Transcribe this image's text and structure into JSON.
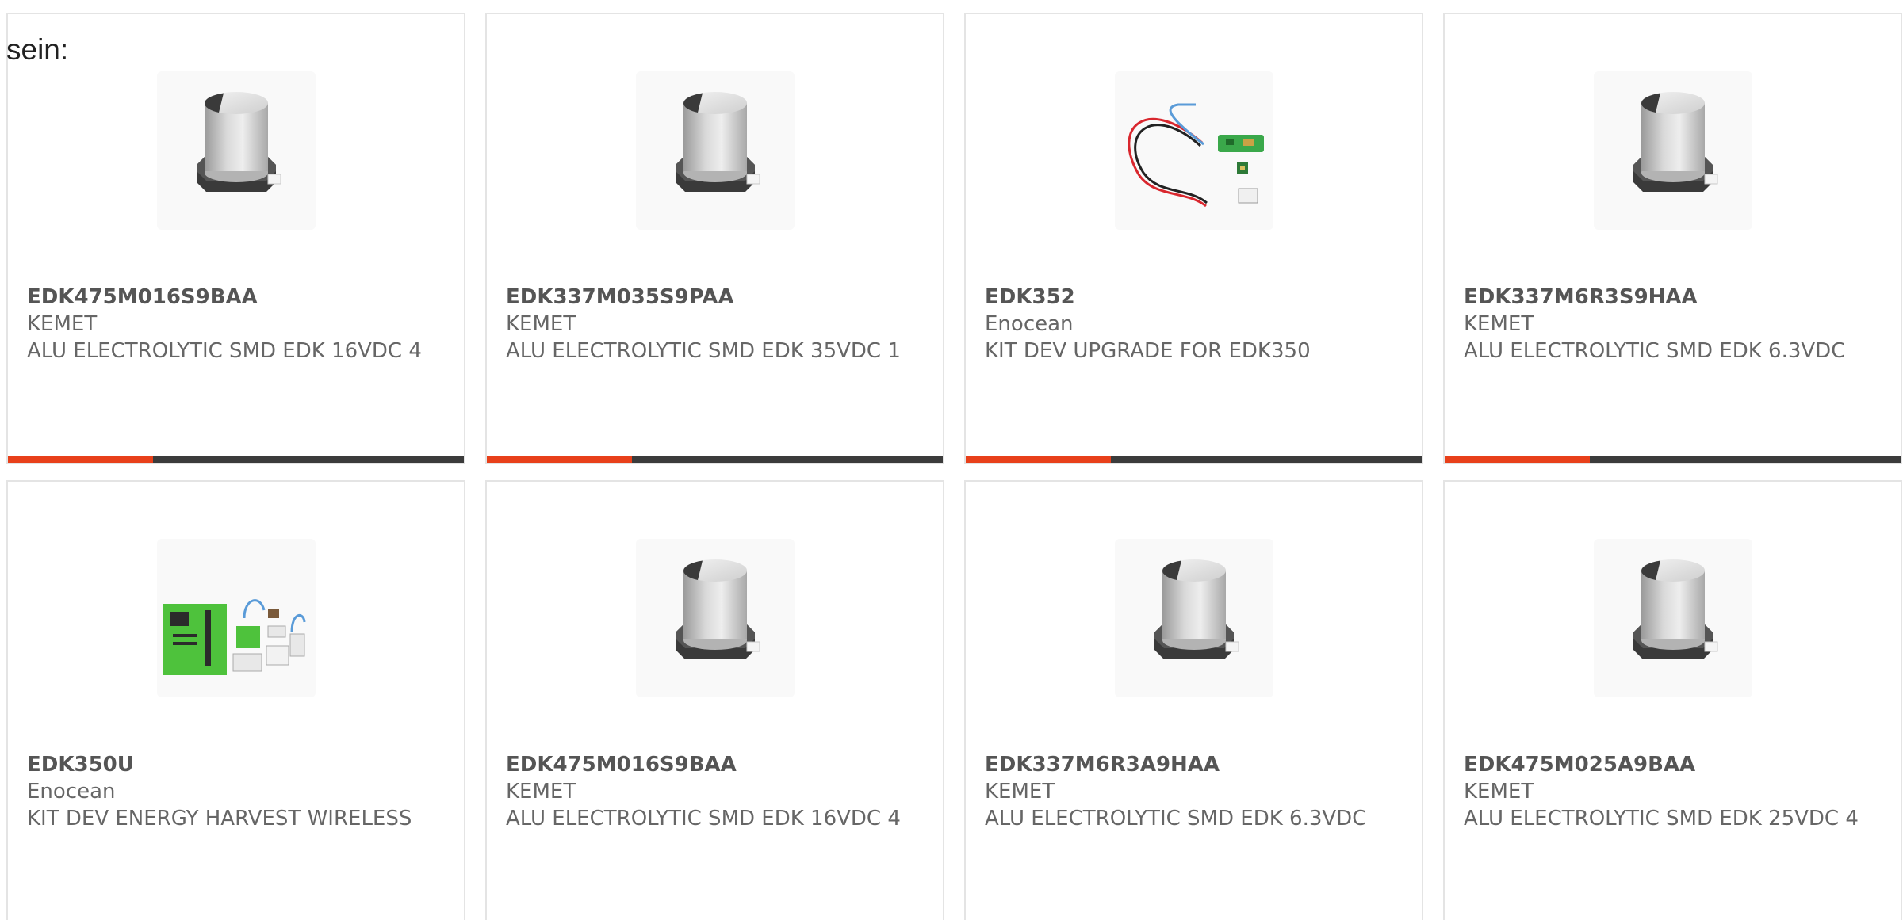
{
  "intro_text": "sein:",
  "colors": {
    "accent": "#e8401a",
    "bar_dark": "#3b3b3b",
    "card_border": "#e4e4e4",
    "text_muted": "#666666"
  },
  "products": [
    {
      "part_number": "EDK475M016S9BAA",
      "manufacturer": "KEMET",
      "description": "ALU ELECTROLYTIC SMD EDK 16VDC 4",
      "image_icon": "capacitor-image"
    },
    {
      "part_number": "EDK337M035S9PAA",
      "manufacturer": "KEMET",
      "description": "ALU ELECTROLYTIC SMD EDK 35VDC 1",
      "image_icon": "capacitor-image"
    },
    {
      "part_number": "EDK352",
      "manufacturer": "Enocean",
      "description": "KIT DEV UPGRADE FOR EDK350",
      "image_icon": "dev-kit-upgrade-image"
    },
    {
      "part_number": "EDK337M6R3S9HAA",
      "manufacturer": "KEMET",
      "description": "ALU ELECTROLYTIC SMD EDK 6.3VDC",
      "image_icon": "capacitor-image"
    },
    {
      "part_number": "EDK350U",
      "manufacturer": "Enocean",
      "description": "KIT DEV ENERGY HARVEST WIRELESS",
      "image_icon": "dev-kit-board-image"
    },
    {
      "part_number": "EDK475M016S9BAA",
      "manufacturer": "KEMET",
      "description": "ALU ELECTROLYTIC SMD EDK 16VDC 4",
      "image_icon": "capacitor-image"
    },
    {
      "part_number": "EDK337M6R3A9HAA",
      "manufacturer": "KEMET",
      "description": "ALU ELECTROLYTIC SMD EDK 6.3VDC",
      "image_icon": "capacitor-image"
    },
    {
      "part_number": "EDK475M025A9BAA",
      "manufacturer": "KEMET",
      "description": "ALU ELECTROLYTIC SMD EDK 25VDC 4",
      "image_icon": "capacitor-image"
    }
  ]
}
